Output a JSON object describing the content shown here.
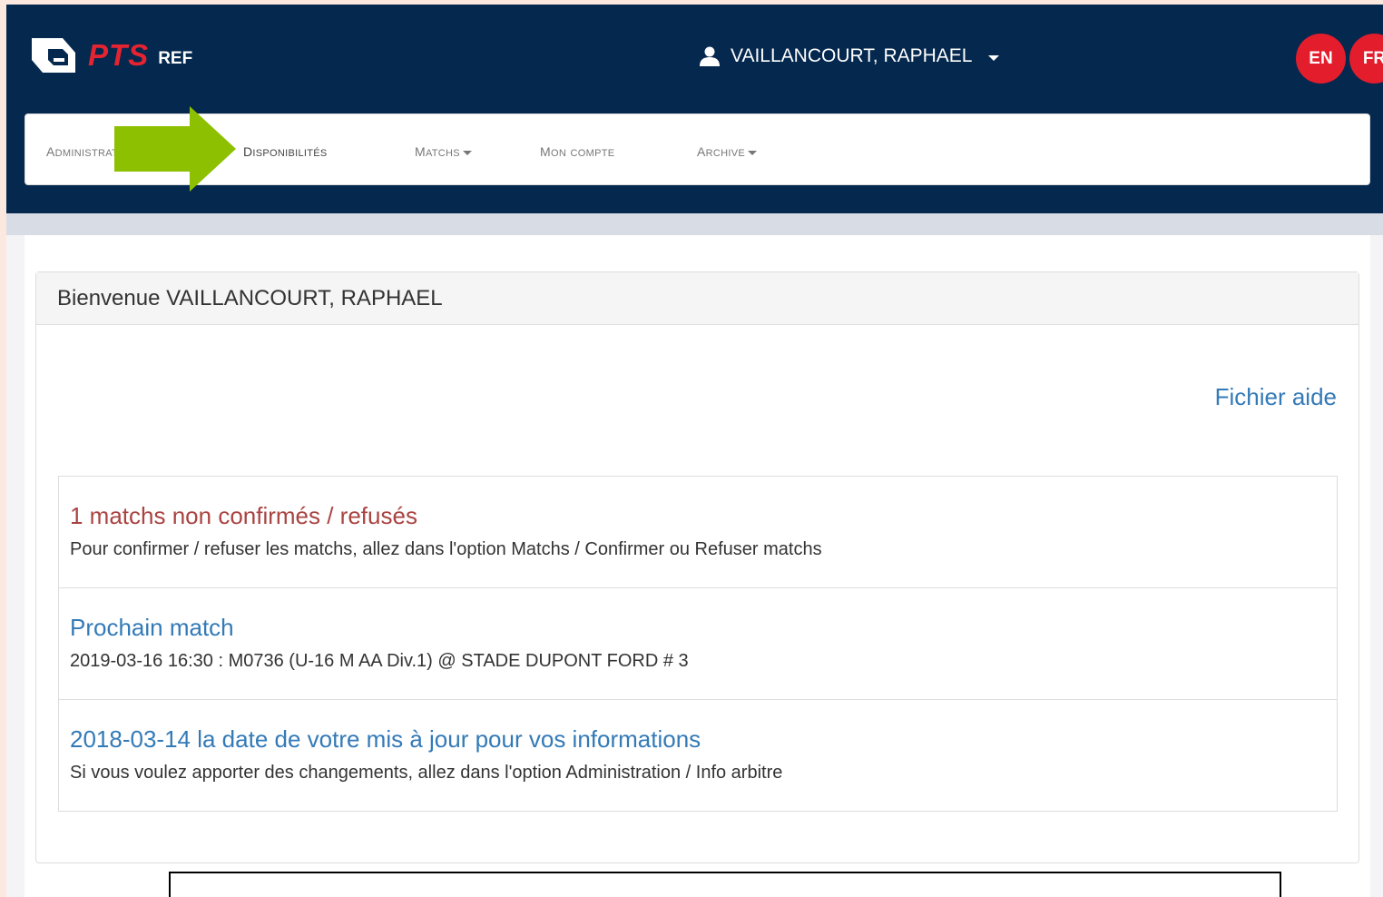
{
  "header": {
    "logo_text": "PTS",
    "logo_sub": "REF",
    "user_name": "VAILLANCOURT, RAPHAEL",
    "languages": [
      "EN",
      "FR"
    ]
  },
  "nav": {
    "items": [
      {
        "first": "A",
        "rest": "dministration"
      },
      {
        "first": "D",
        "rest": "isponibilités"
      },
      {
        "first": "M",
        "rest": "atchs"
      },
      {
        "first": "M",
        "rest": "on compte"
      },
      {
        "first": "A",
        "rest": "rchive"
      }
    ]
  },
  "panel": {
    "welcome": "Bienvenue VAILLANCOURT, RAPHAEL",
    "help_link": "Fichier aide",
    "items": [
      {
        "title": "1 matchs non confirmés / refusés",
        "text": "Pour confirmer / refuser les matchs, allez dans l'option Matchs / Confirmer ou Refuser matchs"
      },
      {
        "title": "Prochain match",
        "text": "2019-03-16 16:30 : M0736 (U-16 M AA Div.1) @ STADE DUPONT FORD # 3"
      },
      {
        "title": "2018-03-14 la date de votre mis à jour pour vos informations",
        "text": "Si vous voulez apporter des changements, allez dans l'option Administration / Info arbitre"
      }
    ]
  },
  "colors": {
    "header_bg": "#04284e",
    "brand_red": "#e52431",
    "link_blue": "#337ab7",
    "alert_red": "#a94442",
    "arrow_green": "#8cc000"
  },
  "icons": {
    "logo": "pts-logo-icon",
    "user": "user-icon",
    "caret": "chevron-down-icon",
    "annotation": "arrow-right-icon"
  }
}
